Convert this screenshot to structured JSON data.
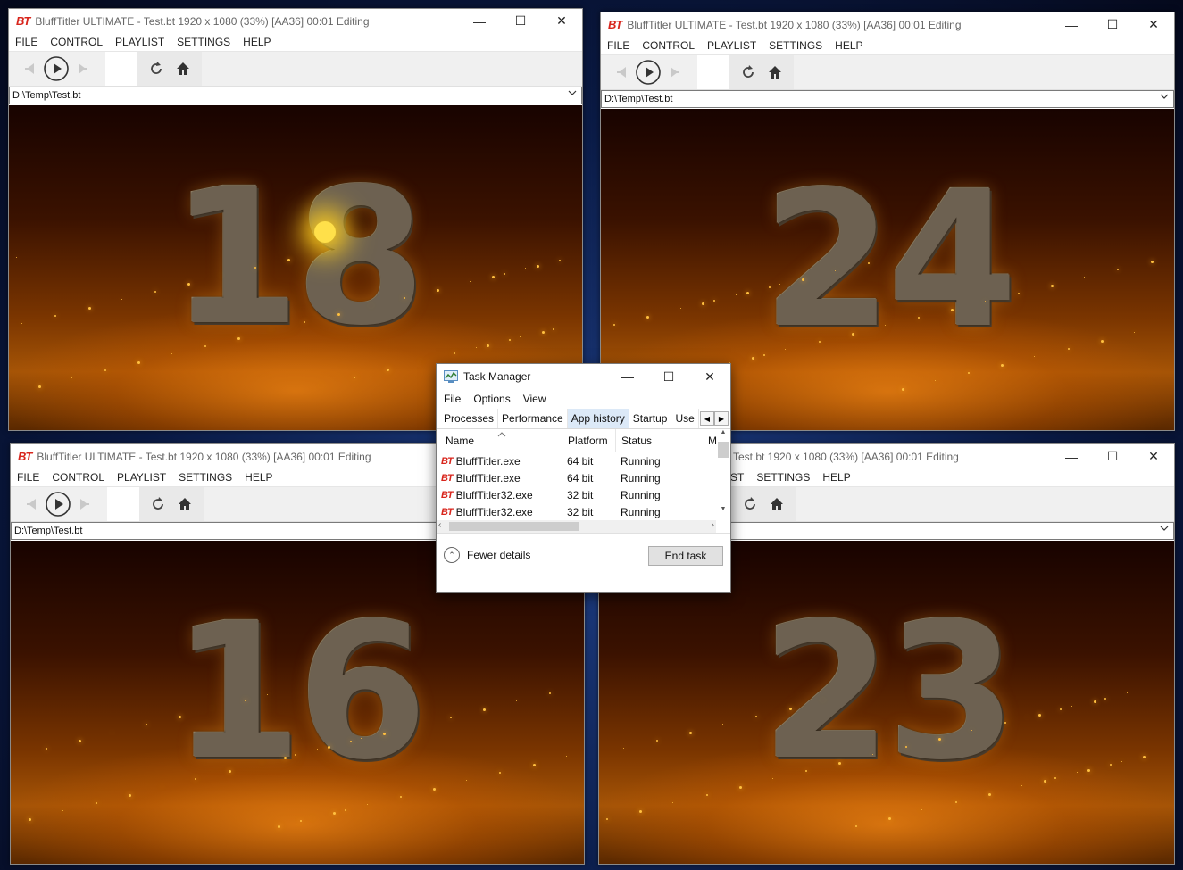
{
  "windows": [
    {
      "title": "BluffTitler ULTIMATE  - Test.bt 1920 x 1080 (33%) [AA36] 00:01 Editing",
      "path": "D:\\Temp\\Test.bt",
      "digits": "18"
    },
    {
      "title": "BluffTitler ULTIMATE  - Test.bt 1920 x 1080 (33%) [AA36] 00:01 Editing",
      "path": "D:\\Temp\\Test.bt",
      "digits": "24"
    },
    {
      "title": "BluffTitler ULTIMATE  - Test.bt 1920 x 1080 (33%) [AA36] 00:01 Editing",
      "path": "D:\\Temp\\Test.bt",
      "digits": "16"
    },
    {
      "title": "Test.bt 1920 x 1080 (33%) [AA36] 00:01 Editing",
      "path": "",
      "digits": "23"
    }
  ],
  "logo": "BT",
  "menu": {
    "file": "FILE",
    "control": "CONTROL",
    "playlist": "PLAYLIST",
    "settings": "SETTINGS",
    "help": "HELP",
    "playlist_partial": "ST"
  },
  "taskmanager": {
    "title": "Task Manager",
    "menu": [
      "File",
      "Options",
      "View"
    ],
    "tabs": [
      "Processes",
      "Performance",
      "App history",
      "Startup",
      "Use"
    ],
    "active_tab": "App history",
    "columns": {
      "name": "Name",
      "platform": "Platform",
      "status": "Status",
      "more": "M"
    },
    "rows": [
      {
        "name": "BluffTitler.exe",
        "platform": "64 bit",
        "status": "Running"
      },
      {
        "name": "BluffTitler.exe",
        "platform": "64 bit",
        "status": "Running"
      },
      {
        "name": "BluffTitler32.exe",
        "platform": "32 bit",
        "status": "Running"
      },
      {
        "name": "BluffTitler32.exe",
        "platform": "32 bit",
        "status": "Running"
      }
    ],
    "fewer_details": "Fewer details",
    "end_task": "End task"
  },
  "colors": {
    "brand": "#d8261d",
    "scene_glow": "#ffb020",
    "desktop": "#0a1a44"
  }
}
